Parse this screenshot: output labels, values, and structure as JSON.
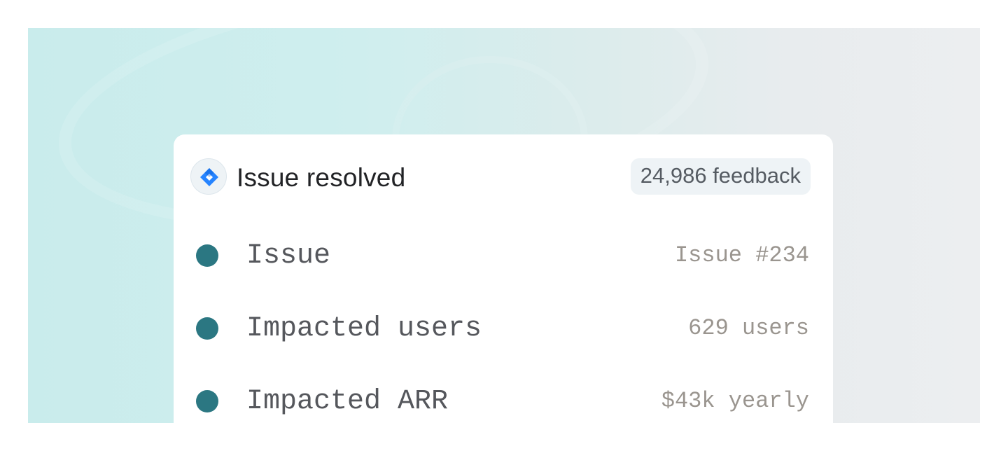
{
  "card": {
    "icon": "jira-diamond-icon",
    "title": "Issue resolved",
    "badge": "24,986 feedback"
  },
  "rows": [
    {
      "label": "Issue",
      "value": "Issue #234"
    },
    {
      "label": "Impacted users",
      "value": "629 users"
    },
    {
      "label": "Impacted ARR",
      "value": "$43k yearly"
    }
  ],
  "colors": {
    "dot": "#2b7782",
    "icon_blue": "#2684ff",
    "badge_bg": "#eef3f6"
  }
}
